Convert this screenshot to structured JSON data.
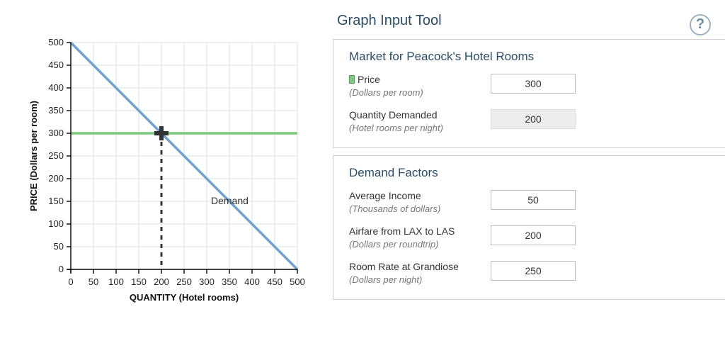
{
  "tool_title": "Graph Input Tool",
  "help_icon": "?",
  "market_panel": {
    "title": "Market for Peacock's Hotel Rooms",
    "price": {
      "label": "Price",
      "sub": "(Dollars per room)",
      "value": "300"
    },
    "qty": {
      "label": "Quantity Demanded",
      "sub": "(Hotel rooms per night)",
      "value": "200"
    }
  },
  "factors_panel": {
    "title": "Demand Factors",
    "income": {
      "label": "Average Income",
      "sub": "(Thousands of dollars)",
      "value": "50"
    },
    "airfare": {
      "label": "Airfare from LAX to LAS",
      "sub": "(Dollars per roundtrip)",
      "value": "200"
    },
    "rival": {
      "label": "Room Rate at Grandiose",
      "sub": "(Dollars per night)",
      "value": "250"
    }
  },
  "chart_data": {
    "type": "line",
    "xlabel": "QUANTITY (Hotel rooms)",
    "ylabel": "PRICE (Dollars per room)",
    "xlim": [
      0,
      500
    ],
    "ylim": [
      0,
      500
    ],
    "xticks": [
      0,
      50,
      100,
      150,
      200,
      250,
      300,
      350,
      400,
      450,
      500
    ],
    "yticks": [
      0,
      50,
      100,
      150,
      200,
      250,
      300,
      350,
      400,
      450,
      500
    ],
    "series": [
      {
        "name": "Demand",
        "x": [
          0,
          500
        ],
        "y": [
          500,
          0
        ],
        "color": "#6fa3d1"
      },
      {
        "name": "Price",
        "x": [
          0,
          500
        ],
        "y": [
          300,
          300
        ],
        "color": "#7dc97d"
      }
    ],
    "marker": {
      "x": 200,
      "y": 300
    },
    "annotations": [
      {
        "text": "Demand",
        "x": 300,
        "y": 150
      }
    ]
  }
}
